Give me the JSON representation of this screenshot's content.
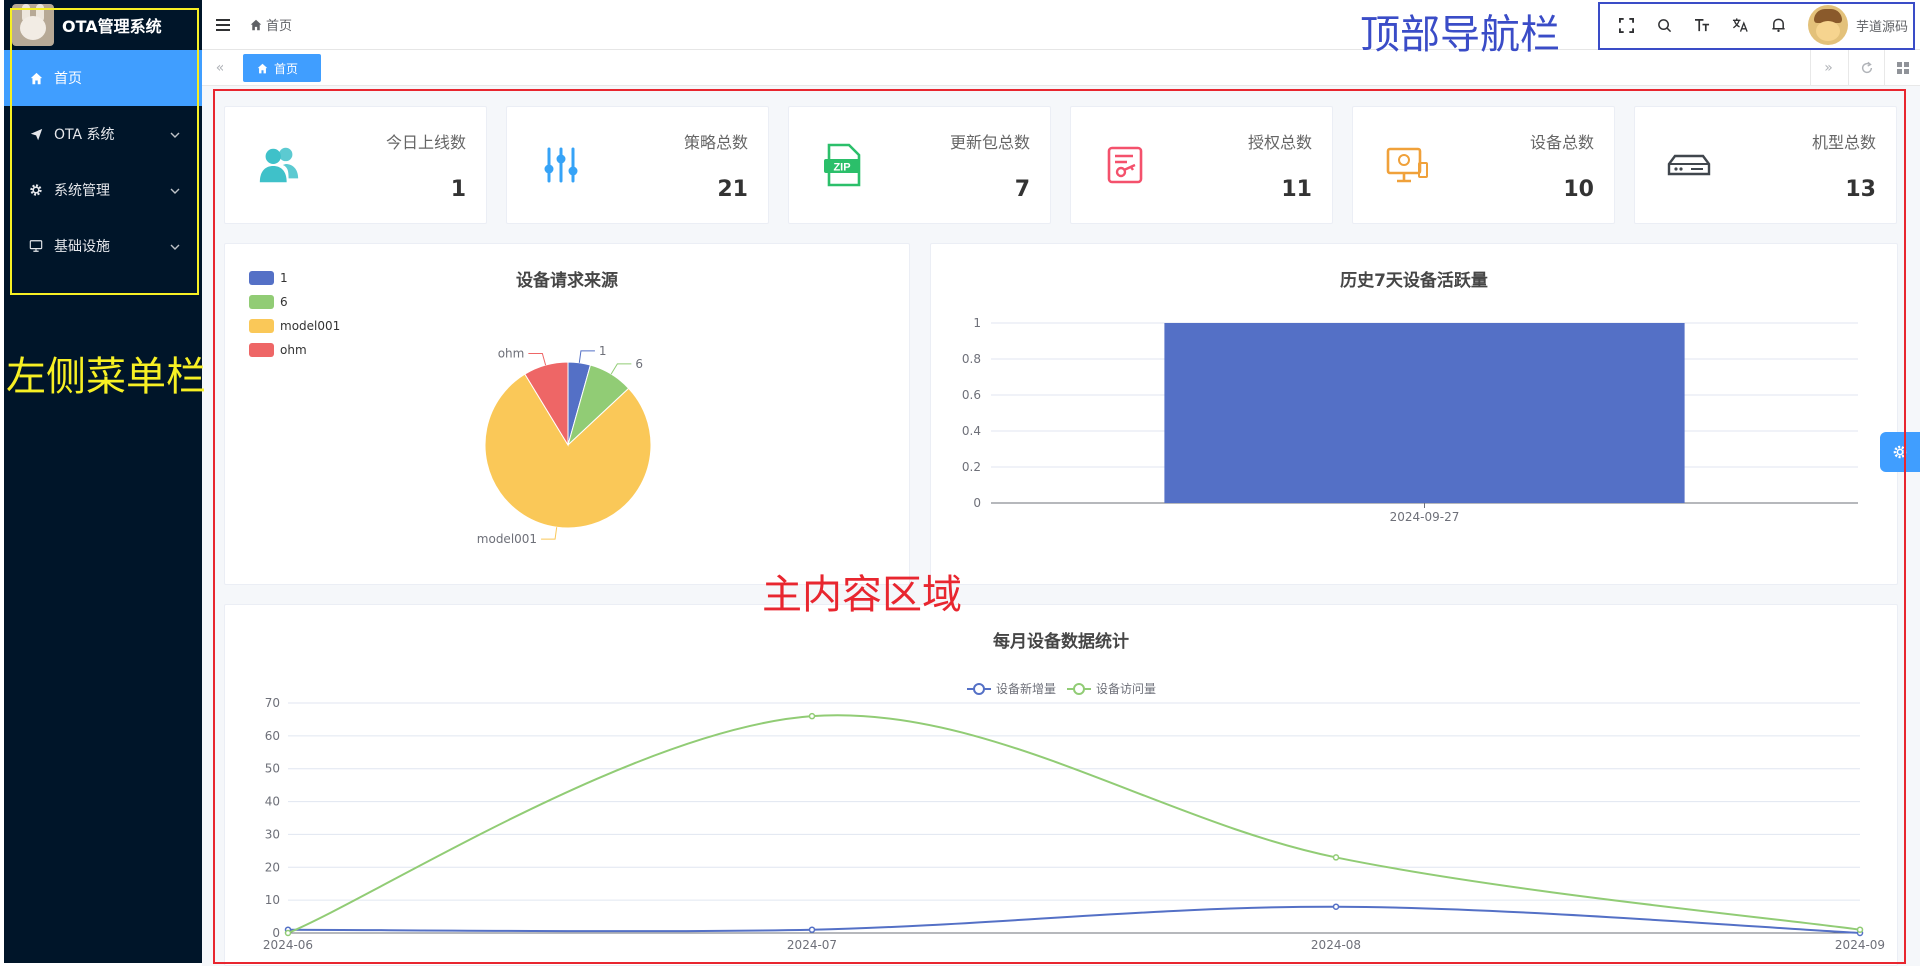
{
  "app": {
    "title": "OTA管理系统"
  },
  "sidebar": {
    "items": [
      {
        "label": "首页",
        "active": true
      },
      {
        "label": "OTA 系统"
      },
      {
        "label": "系统管理"
      },
      {
        "label": "基础设施"
      }
    ]
  },
  "header": {
    "breadcrumb": "首页",
    "user": "芋道源码",
    "tools": [
      "fullscreen-icon",
      "search-icon",
      "font-size-icon",
      "translate-icon",
      "bell-icon"
    ]
  },
  "tags": {
    "active": "首页"
  },
  "annotations": {
    "sidebar": "左侧菜单栏",
    "header": "顶部导航栏",
    "main": "主内容区域"
  },
  "stats": [
    {
      "title": "今日上线数",
      "value": "1",
      "icon": "users-icon",
      "color": "#3fc1c9"
    },
    {
      "title": "策略总数",
      "value": "21",
      "icon": "sliders-icon",
      "color": "#36a3f7"
    },
    {
      "title": "更新包总数",
      "value": "7",
      "icon": "zip-icon",
      "color": "#2bbf6a"
    },
    {
      "title": "授权总数",
      "value": "11",
      "icon": "license-icon",
      "color": "#f4516c"
    },
    {
      "title": "设备总数",
      "value": "10",
      "icon": "monitor-icon",
      "color": "#f0a13a"
    },
    {
      "title": "机型总数",
      "value": "13",
      "icon": "router-icon",
      "color": "#40464d"
    }
  ],
  "chart_data": [
    {
      "type": "pie",
      "title": "设备请求来源",
      "legend_position": "top-left",
      "labels": [
        "1",
        "6",
        "model001",
        "ohm"
      ],
      "values": [
        1,
        2,
        18,
        2
      ],
      "colors": [
        "#5470c6",
        "#91cc75",
        "#fac858",
        "#ee6666"
      ]
    },
    {
      "type": "bar",
      "title": "历史7天设备活跃量",
      "categories": [
        "2024-09-27"
      ],
      "values": [
        1
      ],
      "ylim": [
        0,
        1
      ],
      "yticks": [
        "0",
        "0.2",
        "0.4",
        "0.6",
        "0.8",
        "1"
      ],
      "color": "#5470c6"
    },
    {
      "type": "line",
      "title": "每月设备数据统计",
      "legend_position": "top-center",
      "categories": [
        "2024-06",
        "2024-07",
        "2024-08",
        "2024-09"
      ],
      "ylim": [
        0,
        70
      ],
      "yticks": [
        "0",
        "10",
        "20",
        "30",
        "40",
        "50",
        "60",
        "70"
      ],
      "series": [
        {
          "name": "设备新增量",
          "values": [
            1,
            1,
            8,
            0
          ],
          "color": "#5470c6"
        },
        {
          "name": "设备访问量",
          "values": [
            0,
            66,
            23,
            1
          ],
          "color": "#91cc75"
        }
      ]
    }
  ]
}
